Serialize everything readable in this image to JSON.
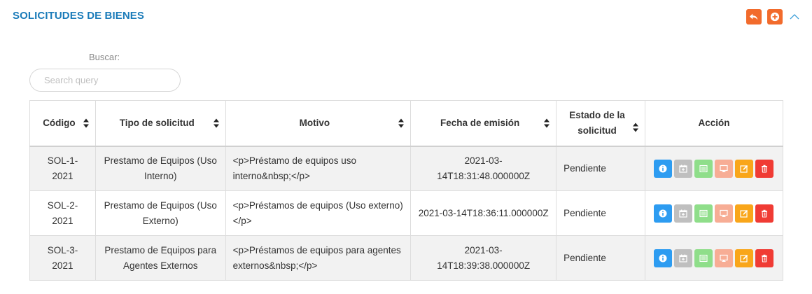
{
  "panel": {
    "title": "SOLICITUDES DE BIENES"
  },
  "header_tools": [
    {
      "icon": "undo-icon",
      "color": "#f26b2c"
    },
    {
      "icon": "add-circle-icon",
      "color": "#f26b2c"
    },
    {
      "icon": "chevron-up-icon",
      "color": "#3fa0d8"
    }
  ],
  "search": {
    "label": "Buscar:",
    "value": "",
    "placeholder": "Search query"
  },
  "table": {
    "columns": [
      {
        "key": "codigo",
        "label": "Código"
      },
      {
        "key": "tipo",
        "label": "Tipo de solicitud"
      },
      {
        "key": "motivo",
        "label": "Motivo"
      },
      {
        "key": "fecha",
        "label": "Fecha de emisión"
      },
      {
        "key": "estado",
        "label": "Estado de la solicitud"
      },
      {
        "key": "accion",
        "label": "Acción"
      }
    ],
    "rows": [
      {
        "codigo": "SOL-1-2021",
        "tipo": "Prestamo de Equipos (Uso Interno)",
        "motivo": "<p>Préstamo de equipos uso interno&nbsp;</p>",
        "fecha": "2021-03-14T18:31:48.000000Z",
        "estado": "Pendiente"
      },
      {
        "codigo": "SOL-2-2021",
        "tipo": "Prestamo de Equipos (Uso Externo)",
        "motivo": "<p>Préstamos de equipos (Uso externo)</p>",
        "fecha": "2021-03-14T18:36:11.000000Z",
        "estado": "Pendiente"
      },
      {
        "codigo": "SOL-3-2021",
        "tipo": "Prestamo de Equipos para Agentes Externos",
        "motivo": "<p>Préstamos de equipos para agentes externos&nbsp;</p>",
        "fecha": "2021-03-14T18:39:38.000000Z",
        "estado": "Pendiente"
      }
    ],
    "row_actions": [
      {
        "icon": "info-icon",
        "color": "#2d9cf1"
      },
      {
        "icon": "calendar-add-icon",
        "color": "#bfbfbf"
      },
      {
        "icon": "list-icon",
        "color": "#8fde8a"
      },
      {
        "icon": "monitor-icon",
        "color": "#f7ad95"
      },
      {
        "icon": "edit-icon",
        "color": "#f9a61a"
      },
      {
        "icon": "trash-icon",
        "color": "#f03b34"
      }
    ]
  }
}
